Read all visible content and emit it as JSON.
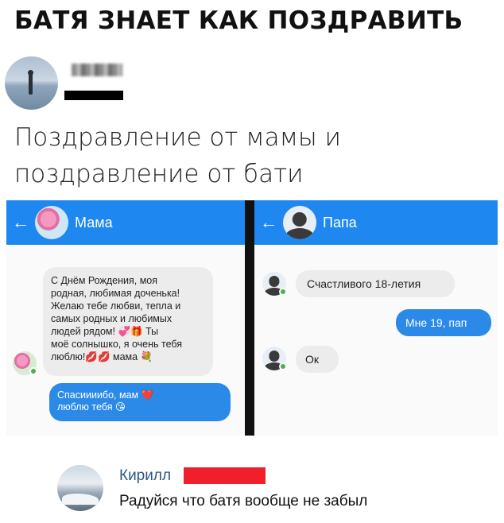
{
  "meme": {
    "title": "БАТЯ ЗНАЕТ КАК ПОЗДРАВИТЬ"
  },
  "post": {
    "text": "Поздравление от мамы и поздравление от бати"
  },
  "chat_mom": {
    "back_icon": "arrow-left-icon",
    "contact_name": "Мама",
    "messages": [
      {
        "direction": "in",
        "lines": [
          "С Днём Рождения, моя",
          "родная, любимая доченька!",
          "Желаю тебе любви, тепла и",
          "самых родных и любимых",
          "людей рядом! 💞🎁 Ты",
          "моё солнышко, я очень тебя",
          "люблю!💋💋 мама 💐"
        ]
      },
      {
        "direction": "out",
        "lines": [
          "Спасиииибо, мам ❤️",
          "люблю тебя 😘"
        ]
      }
    ]
  },
  "chat_dad": {
    "back_icon": "arrow-left-icon",
    "contact_name": "Папа",
    "messages": [
      {
        "direction": "in",
        "text": "Счастливого 18-летия"
      },
      {
        "direction": "out",
        "text": "Мне 19, пап"
      },
      {
        "direction": "in",
        "text": "Ок"
      }
    ]
  },
  "comment": {
    "author": "Кирилл",
    "text": "Радуйся что батя вообще не забыл"
  },
  "colors": {
    "header_blue": "#1e88f0",
    "outgoing_bubble": "#2b8ae8",
    "incoming_bubble": "#ececec",
    "online_green": "#4caf50",
    "redaction_red": "#ef1f2b",
    "link_blue": "#2a5885"
  }
}
